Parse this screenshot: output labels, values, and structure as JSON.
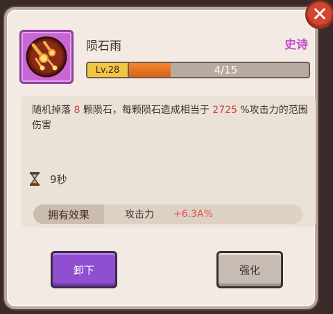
{
  "dialog": {
    "close_symbol": "✕",
    "skill": {
      "icon": "meteor-shower-icon",
      "name": "陨石雨",
      "rarity": "史诗",
      "rarity_color": "#c64fd0",
      "level_label": "Lv.28",
      "progress_text": "4/15",
      "progress_fraction": 0.2667
    },
    "description": {
      "part1": "随机掉落",
      "count": "8",
      "part2": "颗陨石，每颗陨石造成相当于",
      "percent": "2725",
      "part3": "%攻击力的范围伤害"
    },
    "cooldown": {
      "icon": "hourglass-icon",
      "text": "9秒"
    },
    "owned_effect": {
      "label": "拥有效果",
      "stat": "攻击力",
      "value": "+6.3A%",
      "value_color": "#e2504f"
    },
    "buttons": {
      "unequip": "卸下",
      "upgrade": "强化"
    }
  }
}
